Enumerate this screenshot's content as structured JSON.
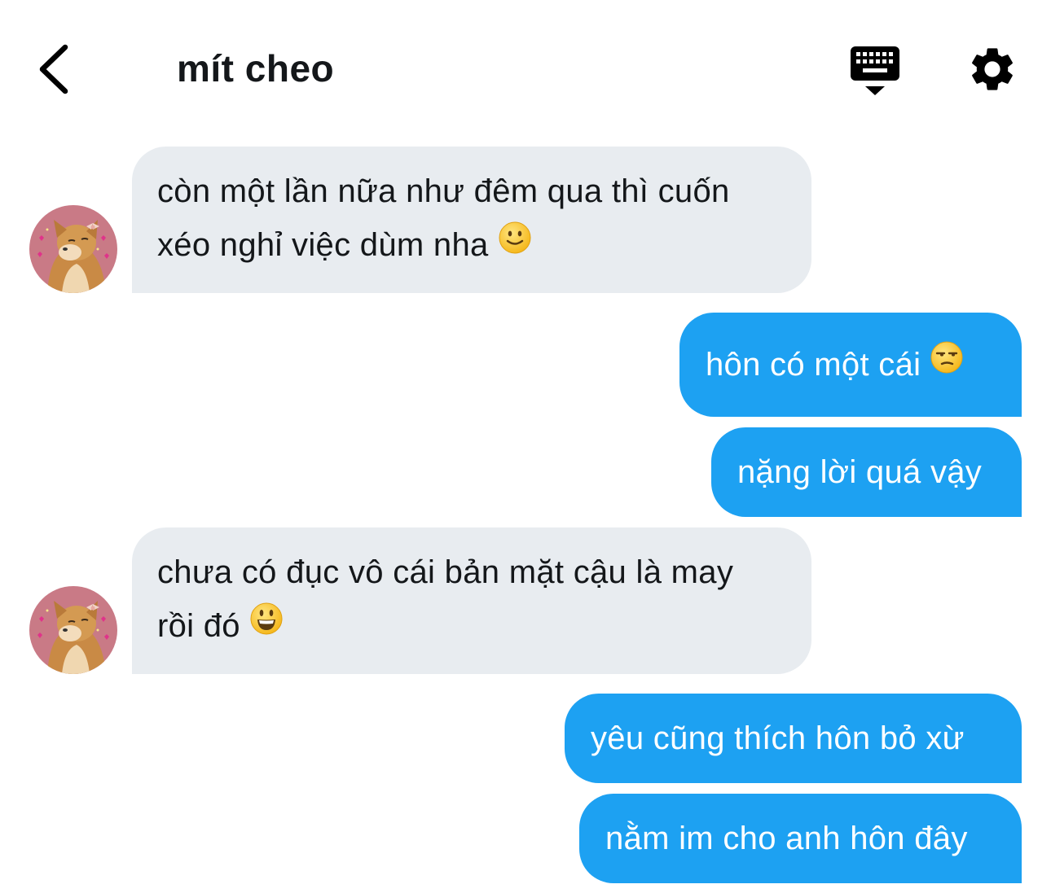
{
  "header": {
    "title": "mít cheo",
    "back_icon": "chevron-left-icon",
    "keyboard_icon": "keyboard-icon",
    "settings_icon": "gear-icon"
  },
  "colors": {
    "incoming_bubble": "#e8ecf0",
    "outgoing_bubble": "#1da1f2",
    "outgoing_text": "#ffffff",
    "incoming_text": "#14171a"
  },
  "messages": [
    {
      "direction": "in",
      "lines": [
        "còn một lần nữa như đêm qua thì cuốn",
        "xéo nghỉ việc dùm nha"
      ],
      "emoji": "slightly-smiling-face"
    },
    {
      "direction": "out",
      "text": "hôn có một cái",
      "emoji": "unamused-face"
    },
    {
      "direction": "out",
      "text": "nặng lời quá vậy"
    },
    {
      "direction": "in",
      "lines": [
        "chưa có đục vô cái bản mặt cậu là may",
        "rồi đó"
      ],
      "emoji": "grinning-face"
    },
    {
      "direction": "out",
      "text": "yêu cũng thích hôn bỏ xừ"
    },
    {
      "direction": "out",
      "text": "nằm im cho anh hôn đây"
    }
  ]
}
